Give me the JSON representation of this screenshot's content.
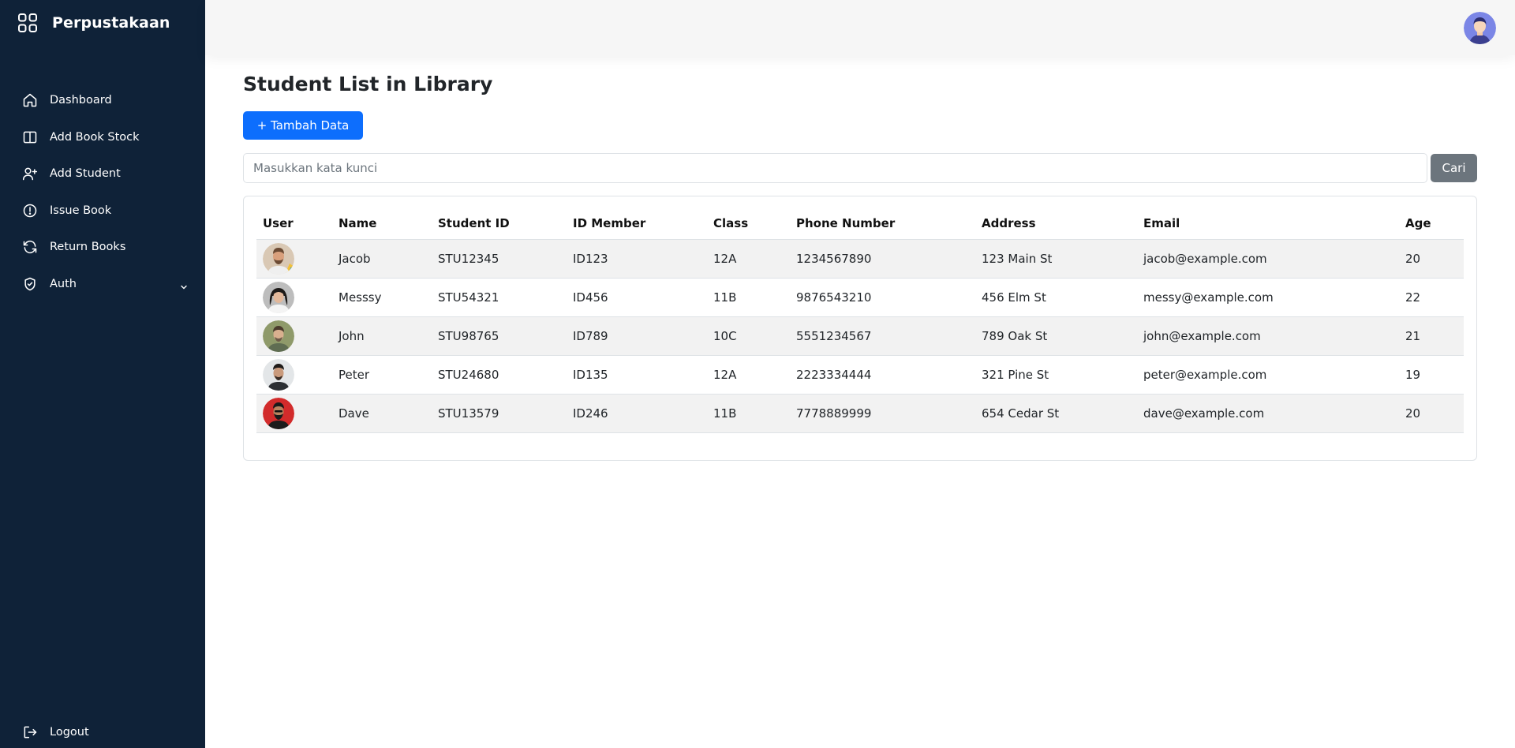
{
  "app": {
    "brand": "Perpustakaan"
  },
  "sidebar": {
    "items": [
      {
        "label": "Dashboard",
        "icon": "home-icon"
      },
      {
        "label": "Add Book Stock",
        "icon": "book-icon"
      },
      {
        "label": "Add Student",
        "icon": "user-plus-icon"
      },
      {
        "label": "Issue Book",
        "icon": "alert-circle-icon"
      },
      {
        "label": "Return Books",
        "icon": "refresh-icon"
      },
      {
        "label": "Auth",
        "icon": "shield-check-icon"
      }
    ],
    "logout_label": "Logout"
  },
  "main": {
    "title": "Student List in Library",
    "add_button_label": "+ Tambah Data",
    "search": {
      "placeholder": "Masukkan kata kunci",
      "value": "",
      "button_label": "Cari"
    },
    "table": {
      "columns": [
        "User",
        "Name",
        "Student ID",
        "ID Member",
        "Class",
        "Phone Number",
        "Address",
        "Email",
        "Age"
      ],
      "rows": [
        {
          "name": "Jacob",
          "student_id": "STU12345",
          "member_id": "ID123",
          "class": "12A",
          "phone": "1234567890",
          "address": "123 Main St",
          "email": "jacob@example.com",
          "age": "20"
        },
        {
          "name": "Messsy",
          "student_id": "STU54321",
          "member_id": "ID456",
          "class": "11B",
          "phone": "9876543210",
          "address": "456 Elm St",
          "email": "messy@example.com",
          "age": "22"
        },
        {
          "name": "John",
          "student_id": "STU98765",
          "member_id": "ID789",
          "class": "10C",
          "phone": "5551234567",
          "address": "789 Oak St",
          "email": "john@example.com",
          "age": "21"
        },
        {
          "name": "Peter",
          "student_id": "STU24680",
          "member_id": "ID135",
          "class": "12A",
          "phone": "2223334444",
          "address": "321 Pine St",
          "email": "peter@example.com",
          "age": "19"
        },
        {
          "name": "Dave",
          "student_id": "STU13579",
          "member_id": "ID246",
          "class": "11B",
          "phone": "7778889999",
          "address": "654 Cedar St",
          "email": "dave@example.com",
          "age": "20"
        }
      ]
    }
  },
  "colors": {
    "sidebar_bg": "#0f2238",
    "primary": "#0d6efd",
    "secondary": "#6c757d",
    "header_bg": "#f6f6f6",
    "stripe": "#f2f2f2"
  }
}
